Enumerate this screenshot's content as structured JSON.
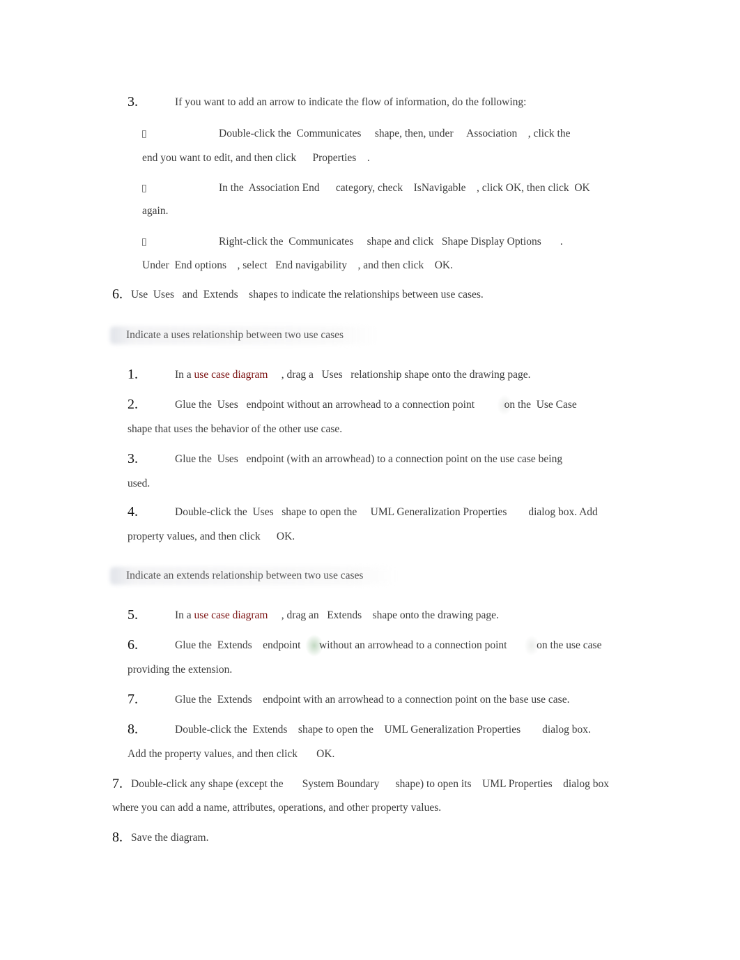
{
  "step3_top": {
    "number": "3.",
    "text": "If you want to add an arrow to indicate the flow of information, do the following:",
    "bullets": [
      {
        "glyph": "",
        "line1": "Double-click the  Communicates     shape, then, under     Association    , click the",
        "line2": "end you want to edit, and then click      Properties    ."
      },
      {
        "glyph": "",
        "line1": "In the  Association End      category, check    IsNavigable    , click OK, then click  OK",
        "line2": "again."
      },
      {
        "glyph": "",
        "line1": "Right-click the  Communicates     shape and click   Shape Display Options       .",
        "line2": "Under  End options    , select   End navigability    , and then click    OK."
      }
    ]
  },
  "step6": {
    "number": "6.",
    "text": "Use  Uses   and  Extends    shapes to indicate the relationships between use cases."
  },
  "section_uses": {
    "heading": "Indicate a uses relationship between two use cases",
    "steps": [
      {
        "number": "1.",
        "pre": "In a ",
        "link": "use case diagram",
        "post": "     , drag a   Uses   relationship shape onto the drawing page."
      },
      {
        "number": "2.",
        "line1": "Glue the  Uses   endpoint without an arrowhead to a connection point           on the  Use Case",
        "line2": "shape that uses the behavior of the other use case."
      },
      {
        "number": "3.",
        "line1": "Glue the  Uses   endpoint (with an arrowhead) to a connection point on the use case being",
        "line2": "used."
      },
      {
        "number": "4.",
        "line1": "Double-click the  Uses   shape to open the     UML Generalization Properties        dialog box. Add",
        "line2": "property values, and then click      OK."
      }
    ]
  },
  "section_extends": {
    "heading": "Indicate an extends relationship between two use cases",
    "steps": [
      {
        "number": "5.",
        "pre": "In a ",
        "link": "use case diagram",
        "post": "     , drag an   Extends    shape onto the drawing page."
      },
      {
        "number": "6.",
        "line1a": "Glue the  Extends    endpoint",
        "line1b": "without an arrowhead to a connection point           on the use case",
        "line2": "providing the extension."
      },
      {
        "number": "7.",
        "line1": "Glue the  Extends    endpoint with an arrowhead to a connection point on the base use case."
      },
      {
        "number": "8.",
        "line1": "Double-click the  Extends    shape to open the    UML Generalization Properties        dialog box.",
        "line2": "Add the property values, and then click       OK."
      }
    ]
  },
  "step7": {
    "number": "7.",
    "line1": "Double-click any shape (except the       System Boundary      shape) to open its    UML Properties    dialog box",
    "line2": "where you can add a name, attributes, operations, and other property values."
  },
  "step8": {
    "number": "8.",
    "text": "Save the diagram."
  },
  "colors": {
    "link": "#7a0f0f",
    "text": "#3c3c3c",
    "number": "#111111"
  }
}
